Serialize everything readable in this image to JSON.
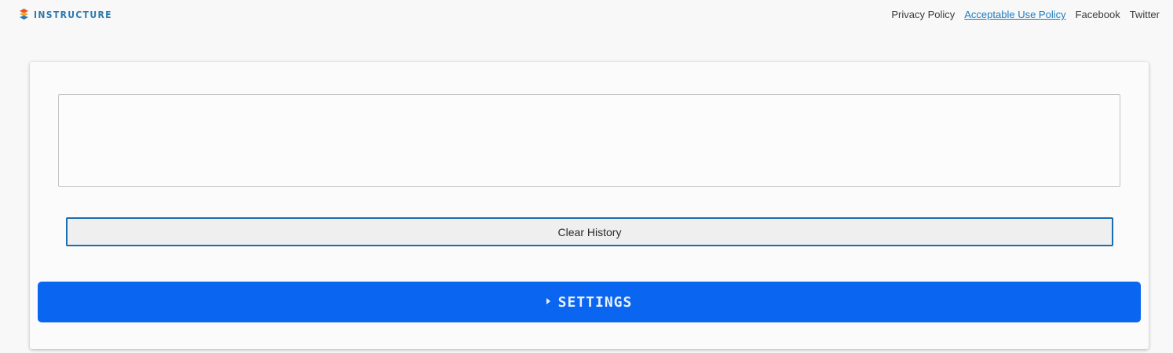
{
  "brand": {
    "name": "INSTRUCTURE",
    "logo_icon": "instructure-logo-icon"
  },
  "nav": {
    "links": [
      {
        "label": "Privacy Policy",
        "active": false
      },
      {
        "label": "Acceptable Use Policy",
        "active": true
      },
      {
        "label": "Facebook",
        "active": false
      },
      {
        "label": "Twitter",
        "active": false
      }
    ]
  },
  "main": {
    "history_text": "",
    "clear_label": "Clear History",
    "settings_label": "SETTINGS",
    "settings_icon": "caret-right-icon"
  },
  "colors": {
    "accent_link": "#1a7bbf",
    "settings_bg": "#0a66f0",
    "clear_border": "#1b6dad",
    "logo_text": "#2a7ab0"
  }
}
